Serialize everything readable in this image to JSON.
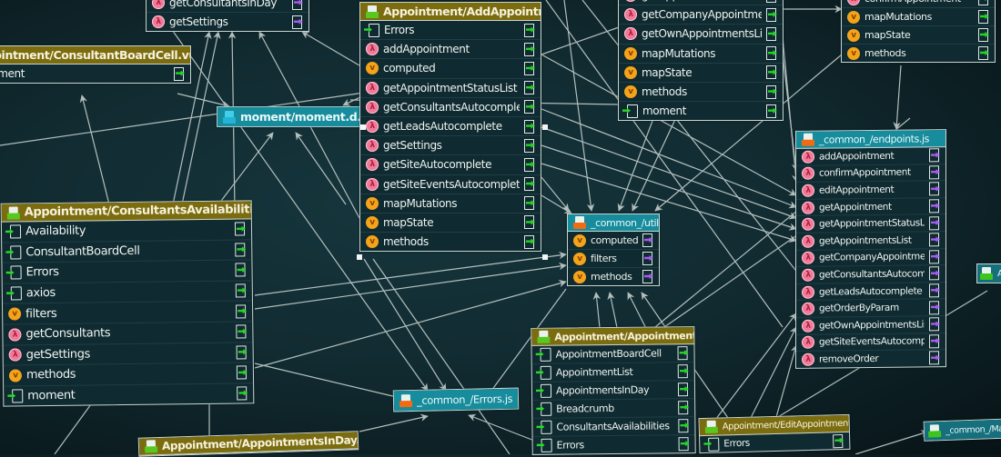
{
  "diagram": {
    "title": "Module dependency diagram",
    "colors": {
      "background": "#112b31",
      "vue_header": "#7b6c10",
      "js_header": "#178c9c",
      "edge": "#cfd9d6",
      "import_arrow": "#27d227",
      "export_arrow_js": "#a75cf0"
    },
    "nodes": {
      "top_left_partial": {
        "title": "",
        "rows": [
          {
            "label": "getConsultantsInDay",
            "icon": "function-icon"
          },
          {
            "label": "getSettings",
            "icon": "function-icon"
          }
        ]
      },
      "consultant_board_cell": {
        "title": "Appointment/ConsultantBoardCell.vue",
        "rows": [
          {
            "label": "moment",
            "icon": "import-icon"
          }
        ]
      },
      "moment_ts": {
        "title": "moment/moment.d.ts"
      },
      "add_appointment": {
        "title": "Appointment/AddAppointment.vue",
        "rows": [
          {
            "label": "Errors",
            "icon": "import-icon"
          },
          {
            "label": "addAppointment",
            "icon": "function-icon"
          },
          {
            "label": "computed",
            "icon": "vue-icon"
          },
          {
            "label": "getAppointmentStatusList",
            "icon": "function-icon"
          },
          {
            "label": "getConsultantsAutocomplete",
            "icon": "function-icon"
          },
          {
            "label": "getLeadsAutocomplete",
            "icon": "function-icon"
          },
          {
            "label": "getSettings",
            "icon": "function-icon"
          },
          {
            "label": "getSiteAutocomplete",
            "icon": "function-icon"
          },
          {
            "label": "getSiteEventsAutocomplete",
            "icon": "function-icon"
          },
          {
            "label": "mapMutations",
            "icon": "vue-icon"
          },
          {
            "label": "mapState",
            "icon": "vue-icon"
          },
          {
            "label": "methods",
            "icon": "vue-icon"
          }
        ]
      },
      "top_center_partial": {
        "title": "",
        "rows": [
          {
            "label": "getAppointmentsList",
            "icon": "function-icon"
          },
          {
            "label": "getCompanyAppointmentsList",
            "icon": "function-icon"
          },
          {
            "label": "getOwnAppointmentsList",
            "icon": "function-icon"
          },
          {
            "label": "mapMutations",
            "icon": "vue-icon"
          },
          {
            "label": "mapState",
            "icon": "vue-icon"
          },
          {
            "label": "methods",
            "icon": "vue-icon"
          },
          {
            "label": "moment",
            "icon": "import-icon"
          }
        ]
      },
      "top_right_partial": {
        "title": "",
        "rows": [
          {
            "label": "confirmAppointment",
            "icon": "function-icon"
          },
          {
            "label": "mapMutations",
            "icon": "vue-icon"
          },
          {
            "label": "mapState",
            "icon": "vue-icon"
          },
          {
            "label": "methods",
            "icon": "vue-icon"
          }
        ]
      },
      "endpoints_js": {
        "title": "_common_/endpoints.js",
        "rows": [
          {
            "label": "addAppointment",
            "icon": "function-icon"
          },
          {
            "label": "confirmAppointment",
            "icon": "function-icon"
          },
          {
            "label": "editAppointment",
            "icon": "function-icon"
          },
          {
            "label": "getAppointment",
            "icon": "function-icon"
          },
          {
            "label": "getAppointmentStatusList",
            "icon": "function-icon"
          },
          {
            "label": "getAppointmentsList",
            "icon": "function-icon"
          },
          {
            "label": "getCompanyAppointmentsList",
            "icon": "function-icon"
          },
          {
            "label": "getConsultantsAutocomplete",
            "icon": "function-icon"
          },
          {
            "label": "getLeadsAutocomplete",
            "icon": "function-icon"
          },
          {
            "label": "getOrderByParam",
            "icon": "function-icon"
          },
          {
            "label": "getOwnAppointmentsList",
            "icon": "function-icon"
          },
          {
            "label": "getSiteEventsAutocomplete",
            "icon": "function-icon"
          },
          {
            "label": "removeOrder",
            "icon": "function-icon"
          }
        ]
      },
      "consultants_availabilities": {
        "title": "Appointment/ConsultantsAvailabilities.vue",
        "rows": [
          {
            "label": "Availability",
            "icon": "import-icon"
          },
          {
            "label": "ConsultantBoardCell",
            "icon": "import-icon"
          },
          {
            "label": "Errors",
            "icon": "import-icon"
          },
          {
            "label": "axios",
            "icon": "import-icon"
          },
          {
            "label": "filters",
            "icon": "vue-icon"
          },
          {
            "label": "getConsultants",
            "icon": "function-icon"
          },
          {
            "label": "getSettings",
            "icon": "function-icon"
          },
          {
            "label": "methods",
            "icon": "vue-icon"
          },
          {
            "label": "moment",
            "icon": "import-icon"
          }
        ]
      },
      "util_js": {
        "title": "_common_/util.js",
        "rows": [
          {
            "label": "computed",
            "icon": "vue-icon"
          },
          {
            "label": "filters",
            "icon": "vue-icon"
          },
          {
            "label": "methods",
            "icon": "vue-icon"
          }
        ]
      },
      "errors_js": {
        "title": "_common_/Errors.js"
      },
      "appointment_vue": {
        "title": "Appointment/Appointment.vue",
        "rows": [
          {
            "label": "AppointmentBoardCell",
            "icon": "import-icon"
          },
          {
            "label": "AppointmentList",
            "icon": "import-icon"
          },
          {
            "label": "AppointmentsInDay",
            "icon": "import-icon"
          },
          {
            "label": "Breadcrumb",
            "icon": "import-icon"
          },
          {
            "label": "ConsultantsAvailabilities",
            "icon": "import-icon"
          },
          {
            "label": "Errors",
            "icon": "import-icon"
          }
        ]
      },
      "appointments_in_day": {
        "title": "Appointment/AppointmentsInDay.vue"
      },
      "edit_appointment": {
        "title": "Appointment/EditAppointment.vue",
        "rows": [
          {
            "label": "Errors",
            "icon": "import-icon"
          }
        ]
      },
      "mapping_partial": {
        "title": "_common_/Mapping"
      },
      "right_edge_partial": {
        "title": "Ad"
      }
    }
  }
}
